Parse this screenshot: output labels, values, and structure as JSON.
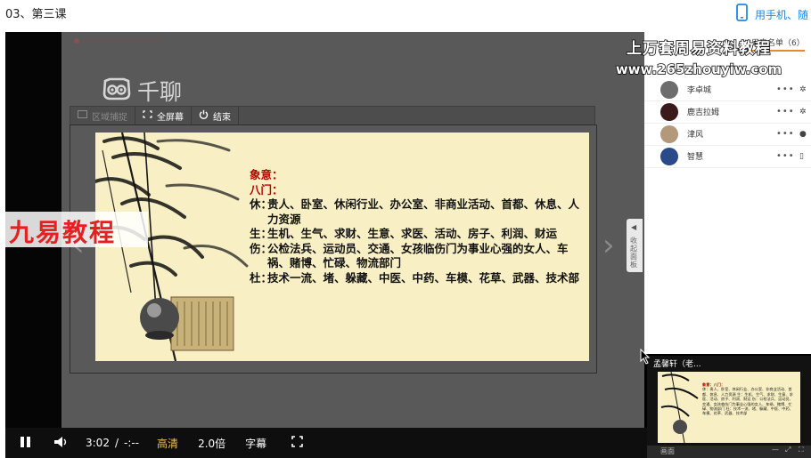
{
  "page": {
    "title": "03、第三课",
    "mobile_link_label": "用手机、随"
  },
  "watermarks": {
    "left": "九易教程",
    "right_line1": "上万套周易资料教程",
    "right_line2": "www.265zhouyiw.com"
  },
  "stage": {
    "app_logo": "千聊"
  },
  "share_toolbar": {
    "region_label": "区域捕捉",
    "fullscreen_label": "全屏幕",
    "end_label": "结束"
  },
  "slide": {
    "heading1": "象意：",
    "heading2": "八门：",
    "rows": [
      {
        "key": "休：",
        "value": "贵人、卧室、休闲行业、办公室、非商业活动、首都、休息、人力资源"
      },
      {
        "key": "生：",
        "value": "生机、生气、求财、生意、求医、活动、房子、利润、财运"
      },
      {
        "key": "伤：",
        "value": "公检法兵、运动员、交通、女孩临伤门为事业心强的女人、车祸、赌博、忙碌、物流部门"
      },
      {
        "key": "杜：",
        "value": "技术一流、堵、躲藏、中医、中药、车模、花草、武器、技术部"
      }
    ]
  },
  "collapse_tab": {
    "label": "收起面板"
  },
  "user_panel": {
    "header": "用户名单（6）",
    "users": [
      {
        "name": "李卓城",
        "avatar_color": "#6d6d6d"
      },
      {
        "name": "鹿吉拉姆",
        "avatar_color": "#3a1a1a"
      },
      {
        "name": "津风",
        "avatar_color": "#b3987a"
      },
      {
        "name": "智慧",
        "avatar_color": "#2a4a8a"
      }
    ],
    "more_label": "•••"
  },
  "camera": {
    "name": "孟馨轩（老...",
    "mini_heading": "象意：八门：",
    "mini_text": "休：贵人、卧室、休闲行业、办公室、非商业活动、首都、休息、人力资源 生：生机、生气、求财、生意、求医、活动、房子、利润、财运 伤：公检法兵、运动员、交通、女孩临伤门为事业心强的女人、车祸、赌博、忙碌、物流部门 杜：技术一流、堵、躲藏、中医、中药、车模、花草、武器、技术部",
    "toolbar_label": "画面"
  },
  "player": {
    "time_current": "3:02",
    "time_separator": "/",
    "time_total": "-:--",
    "quality": "高清",
    "speed": "2.0倍",
    "subtitle": "字幕"
  },
  "colors": {
    "accent": "#1e88e5",
    "quality_gold": "#f2c14e",
    "watermark_red": "#e62020",
    "slide_bg": "#f8f0c4",
    "slide_heading_red": "#c00000",
    "panel_header_line": "#e68a2e"
  }
}
